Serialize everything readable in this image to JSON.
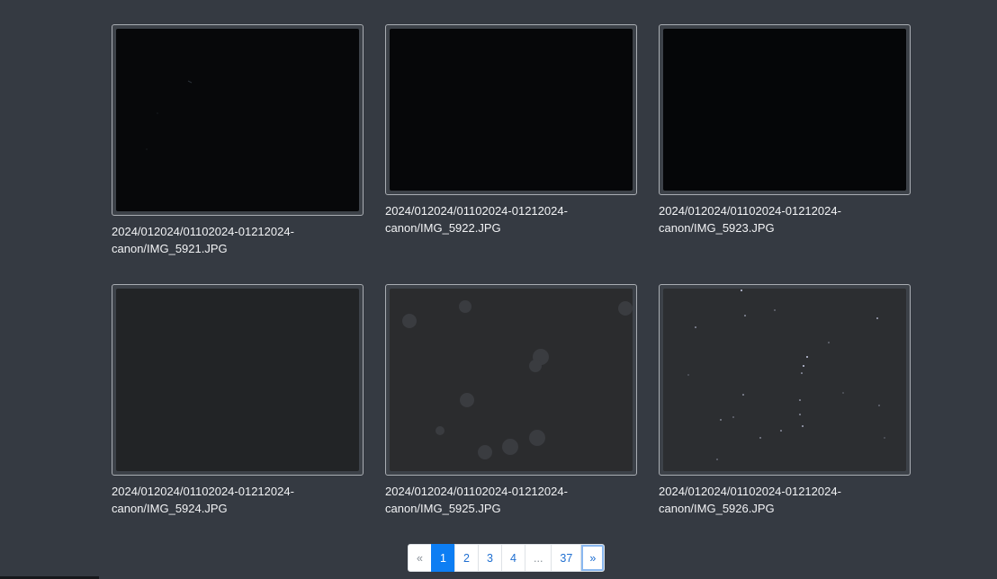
{
  "gallery": {
    "items": [
      {
        "line1": "2024/012024/01102024-01212024-",
        "line2": "canon/IMG_5921.JPG"
      },
      {
        "line1": "2024/012024/01102024-01212024-",
        "line2": "canon/IMG_5922.JPG"
      },
      {
        "line1": "2024/012024/01102024-01212024-",
        "line2": "canon/IMG_5923.JPG"
      },
      {
        "line1": "2024/012024/01102024-01212024-",
        "line2": "canon/IMG_5924.JPG"
      },
      {
        "line1": "2024/012024/01102024-01212024-",
        "line2": "canon/IMG_5925.JPG"
      },
      {
        "line1": "2024/012024/01102024-01212024-",
        "line2": "canon/IMG_5926.JPG"
      }
    ]
  },
  "pagination": {
    "prev": "«",
    "pages": [
      "1",
      "2",
      "3",
      "4"
    ],
    "ellipsis": "...",
    "last": "37",
    "next": "»"
  },
  "colors": {
    "background": "#353a42",
    "active_page": "#0d7ef3",
    "link": "#1f6fd1"
  }
}
